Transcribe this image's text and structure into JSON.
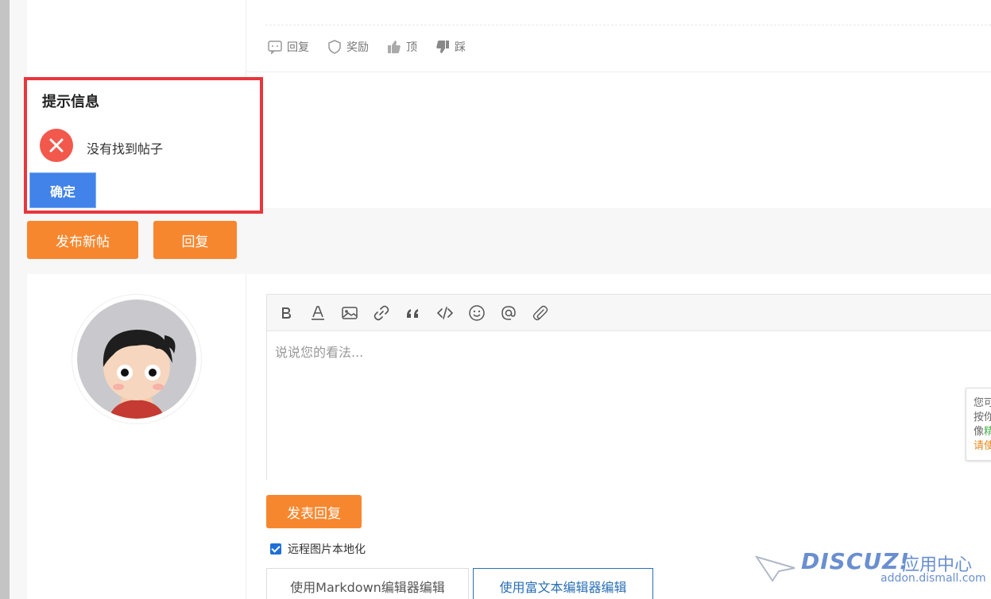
{
  "post_actions": {
    "reply": "回复",
    "reward": "奖励",
    "up": "顶",
    "down": "踩"
  },
  "dialog": {
    "title": "提示信息",
    "message": "没有找到帖子",
    "ok_label": "确定"
  },
  "buttons": {
    "new_post": "发布新帖",
    "reply": "回复",
    "submit_reply": "发表回复"
  },
  "editor": {
    "toolbar": [
      "bold-icon",
      "font-color-icon",
      "image-icon",
      "link-icon",
      "quote-icon",
      "code-icon",
      "emoji-icon",
      "mention-icon",
      "attachment-icon"
    ],
    "placeholder": "说说您的看法..."
  },
  "tooltip": {
    "line1": "您可",
    "line2": "按你",
    "line3_prefix": "像",
    "line3_green": "精",
    "line4": "请使"
  },
  "remote_image": {
    "checked": true,
    "label": "远程图片本地化"
  },
  "editor_tabs": {
    "markdown": "使用Markdown编辑器编辑",
    "rich": "使用富文本编辑器编辑"
  },
  "watermark": {
    "logo_text": "DISCUZ!",
    "cn_text": "应用中心",
    "url": "addon.dismall.com"
  },
  "colors": {
    "accent_orange": "#f7872e",
    "dialog_border": "#e8363c",
    "ok_blue": "#4183e8",
    "error_red": "#f2584c"
  }
}
